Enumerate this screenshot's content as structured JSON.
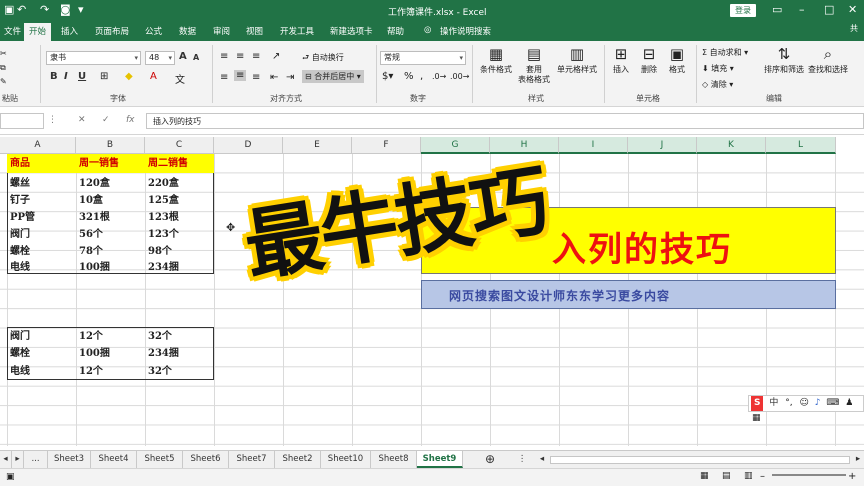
{
  "title_bar": {
    "title": "工作簿课件.xlsx - Excel",
    "login": "登录",
    "quick_access": [
      "save-icon",
      "undo-icon",
      "redo-icon",
      "camera-icon"
    ]
  },
  "ribbon_tabs": [
    "文件",
    "开始",
    "插入",
    "页面布局",
    "公式",
    "数据",
    "审阅",
    "视图",
    "开发工具",
    "新建选项卡",
    "帮助",
    "操作说明搜索"
  ],
  "active_tab": "开始",
  "ribbon": {
    "clipboard": {
      "label": "粘贴"
    },
    "font": {
      "name": "隶书",
      "size": "48",
      "label": "字体",
      "bold": "B",
      "italic": "I",
      "underline": "U",
      "grow": "A",
      "shrink": "A"
    },
    "alignment": {
      "label": "对齐方式",
      "wrap": "自动换行",
      "merge": "合并后居中"
    },
    "number": {
      "format": "常规",
      "label": "数字",
      "percent": "%",
      "comma": ","
    },
    "styles": {
      "label": "样式",
      "cond": "条件格式",
      "table": "套用\n表格格式",
      "cell": "单元格样式"
    },
    "cells": {
      "label": "单元格",
      "insert": "插入",
      "delete": "删除",
      "format": "格式"
    },
    "editing": {
      "label": "编辑",
      "autosum": "自动求和",
      "fill": "填充",
      "clear": "清除",
      "sort": "排序和筛选",
      "find": "查找和选择"
    },
    "share": "共"
  },
  "formula_bar": {
    "content": "插入列的技巧"
  },
  "columns": [
    "A",
    "B",
    "C",
    "D",
    "E",
    "F",
    "G",
    "H",
    "I",
    "J",
    "K",
    "L"
  ],
  "table1": {
    "headers": [
      "商品",
      "周一销售",
      "周二销售"
    ],
    "rows": [
      [
        "螺丝",
        "120盒",
        "220盒"
      ],
      [
        "钉子",
        "10盒",
        "125盒"
      ],
      [
        "PP管",
        "321根",
        "123根"
      ],
      [
        "阀门",
        "56个",
        "123个"
      ],
      [
        "螺栓",
        "78个",
        "98个"
      ],
      [
        "电线",
        "100捆",
        "234捆"
      ]
    ]
  },
  "table2": {
    "rows": [
      [
        "阀门",
        "12个",
        "32个"
      ],
      [
        "螺栓",
        "100捆",
        "234捆"
      ],
      [
        "电线",
        "12个",
        "32个"
      ]
    ]
  },
  "overlay": {
    "big_word": "最牛技巧",
    "banner_title": "入列的技巧",
    "banner_sub": "网页搜索图文设计师东东学习更多内容"
  },
  "ime": {
    "logo": "S",
    "lang": "中"
  },
  "sheet_tabs": [
    "...",
    "Sheet3",
    "Sheet4",
    "Sheet5",
    "Sheet6",
    "Sheet7",
    "Sheet2",
    "Sheet10",
    "Sheet8",
    "Sheet9"
  ],
  "active_sheet": "Sheet9",
  "colors": {
    "excel_green": "#217346",
    "highlight_yellow": "#ffff00",
    "header_red": "#d00000"
  }
}
